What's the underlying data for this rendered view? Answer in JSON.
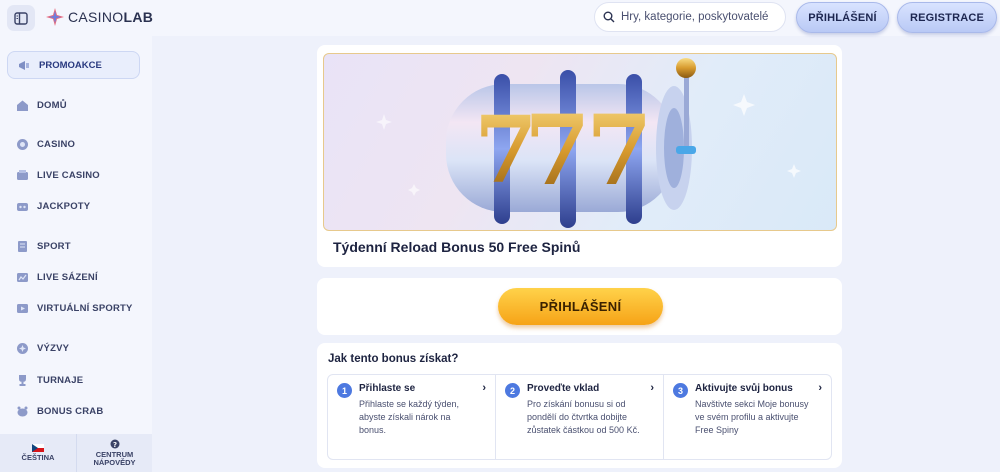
{
  "header": {
    "logo_text_a": "CASINO",
    "logo_text_b": "LAB",
    "search_placeholder": "Hry, kategorie, poskytovatelé",
    "login_label": "PŘIHLÁŠENÍ",
    "register_label": "REGISTRACE"
  },
  "sidebar": {
    "promo_label": "PROMOAKCE",
    "items": [
      {
        "label": "DOMŮ",
        "icon": "home-icon"
      },
      {
        "label": "CASINO",
        "icon": "casino-chip-icon"
      },
      {
        "label": "LIVE CASINO",
        "icon": "live-casino-icon"
      },
      {
        "label": "JACKPOTY",
        "icon": "jackpot-icon"
      },
      {
        "label": "SPORT",
        "icon": "sport-icon"
      },
      {
        "label": "LIVE SÁZENÍ",
        "icon": "live-betting-icon"
      },
      {
        "label": "VIRTUÁLNÍ SPORTY",
        "icon": "virtual-sports-icon"
      },
      {
        "label": "VÝZVY",
        "icon": "challenges-icon"
      },
      {
        "label": "TURNAJE",
        "icon": "trophy-icon"
      },
      {
        "label": "BONUS CRAB",
        "icon": "bonus-crab-icon"
      }
    ],
    "language_label": "ČEŠTINA",
    "help_label_1": "CENTRUM",
    "help_label_2": "NÁPOVĚDY"
  },
  "main": {
    "banner_title": "Týdenní Reload Bonus 50 Free Spinů",
    "login_button": "PŘIHLÁŠENÍ",
    "steps_title": "Jak tento bonus získat?",
    "steps": [
      {
        "num": "1",
        "title": "Přihlaste se",
        "desc": "Přihlaste se každý týden, abyste získali nárok na bonus."
      },
      {
        "num": "2",
        "title": "Proveďte vklad",
        "desc": "Pro získání bonusu si od pondělí do čtvrtka dobijte zůstatek částkou od 500 Kč."
      },
      {
        "num": "3",
        "title": "Aktivujte svůj bonus",
        "desc": "Navštivte sekci Moje bonusy ve svém profilu a aktivujte Free Spiny"
      }
    ],
    "reel_symbol": "7"
  },
  "colors": {
    "accent": "#4d79e0",
    "cta": "#f6a317",
    "page_bg": "#eef1fb"
  }
}
